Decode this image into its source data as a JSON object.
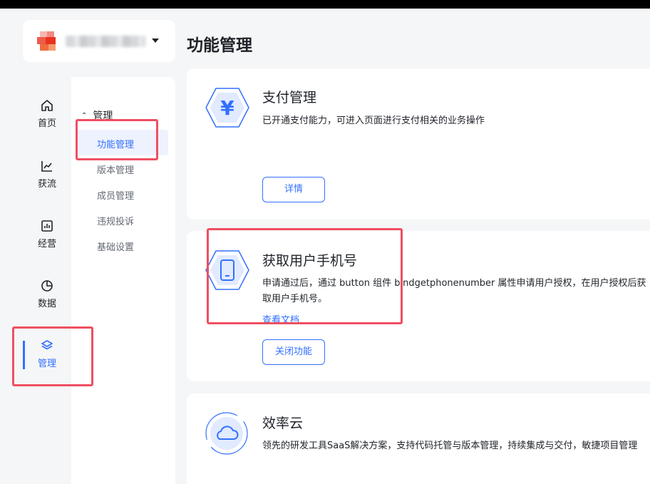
{
  "page": {
    "title": "功能管理"
  },
  "app_switcher": {
    "logo": "pixelated-app-logo",
    "name": ""
  },
  "nav_rail": {
    "items": [
      {
        "icon": "home-icon",
        "label": "首页"
      },
      {
        "icon": "line-chart-icon",
        "label": "获流"
      },
      {
        "icon": "bar-chart-icon",
        "label": "经营"
      },
      {
        "icon": "pie-chart-icon",
        "label": "数据"
      },
      {
        "icon": "layers-icon",
        "label": "管理",
        "active": true
      }
    ]
  },
  "sub_nav": {
    "group_label": "管理",
    "items": [
      {
        "label": "功能管理",
        "active": true
      },
      {
        "label": "版本管理"
      },
      {
        "label": "成员管理"
      },
      {
        "label": "违规投诉"
      },
      {
        "label": "基础设置"
      }
    ]
  },
  "cards": [
    {
      "icon": "yuan-icon",
      "title": "支付管理",
      "desc": "已开通支付能力，可进入页面进行支付相关的业务操作",
      "button": "详情"
    },
    {
      "icon": "phone-icon",
      "title": "获取用户手机号",
      "desc": "申请通过后，通过 button 组件 bindgetphonenumber 属性申请用户授权，在用户授权后获取用户手机号。",
      "link": "查看文档",
      "button": "关闭功能"
    },
    {
      "icon": "cloud-icon",
      "title": "效率云",
      "desc": "领先的研发工具SaaS解决方案，支持代码托管与版本管理，持续集成与交付，敏捷项目管理"
    }
  ],
  "colors": {
    "accent": "#3370ff",
    "highlight": "#ef4f62",
    "background": "#f5f6f7"
  }
}
